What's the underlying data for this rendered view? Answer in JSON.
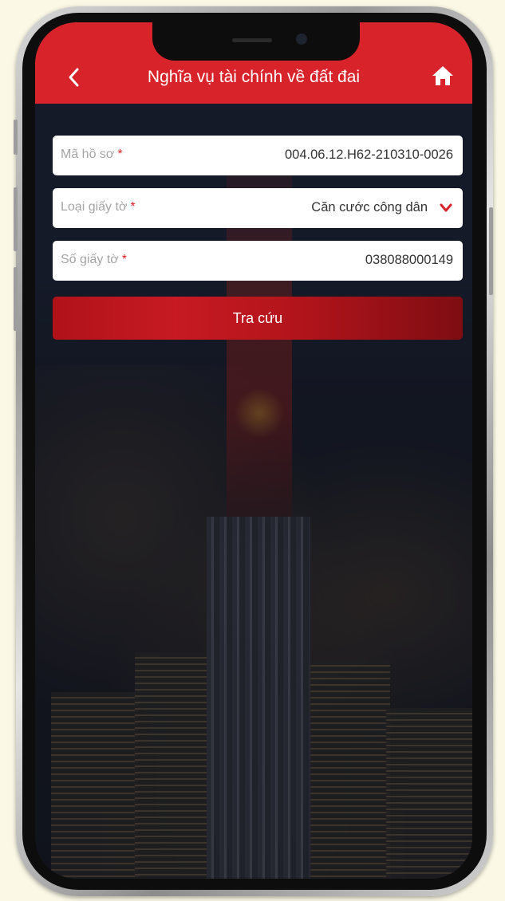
{
  "header": {
    "title": "Nghĩa vụ tài chính về đất đai",
    "back_icon": "chevron-left-icon",
    "home_icon": "home-icon"
  },
  "form": {
    "fields": [
      {
        "label": "Mã hồ sơ",
        "required_mark": "*",
        "value": "004.06.12.H62-210310-0026"
      },
      {
        "label": "Loại giấy tờ",
        "required_mark": "*",
        "value": "Căn cước công dân",
        "icon": "chevron-down-icon"
      },
      {
        "label": "Số giấy tờ",
        "required_mark": "*",
        "value": "038088000149"
      }
    ],
    "submit_label": "Tra cứu"
  },
  "colors": {
    "header": "#d8232a",
    "button": "#b0121a",
    "required": "#d8232a"
  }
}
